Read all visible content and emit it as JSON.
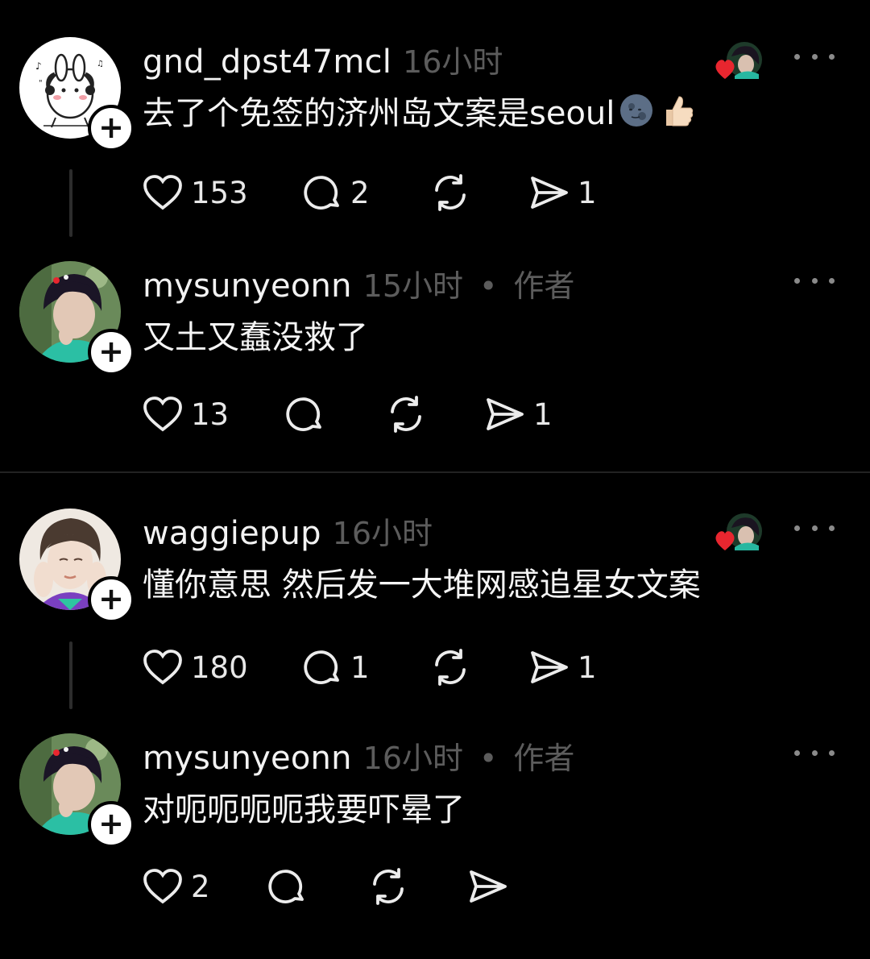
{
  "threads": [
    {
      "comment": {
        "username": "gnd_dpst47mcl",
        "time": "16小时",
        "text": "去了个免签的济州岛文案是seoul",
        "emojis": [
          "new-moon-face",
          "thumbs-up"
        ],
        "likes": "153",
        "replies": "2",
        "reposts": "",
        "shares": "1",
        "liked_by_author": true
      },
      "reply": {
        "username": "mysunyeonn",
        "time": "15小时",
        "separator": "•",
        "author_tag": "作者",
        "text": "又土又蠢没救了",
        "likes": "13",
        "replies": "",
        "reposts": "",
        "shares": "1"
      }
    },
    {
      "comment": {
        "username": "waggiepup",
        "time": "16小时",
        "text": "懂你意思 然后发一大堆网感追星女文案",
        "likes": "180",
        "replies": "1",
        "reposts": "",
        "shares": "1",
        "liked_by_author": true
      },
      "reply": {
        "username": "mysunyeonn",
        "time": "16小时",
        "separator": "•",
        "author_tag": "作者",
        "text": "对呃呃呃呃我要吓晕了",
        "likes": "2",
        "replies": "",
        "reposts": "",
        "shares": ""
      }
    }
  ],
  "follow_symbol": "+",
  "colors": {
    "background": "#000000",
    "text": "#f5f5f5",
    "muted": "#5c5c5c",
    "heart": "#e8262f"
  }
}
